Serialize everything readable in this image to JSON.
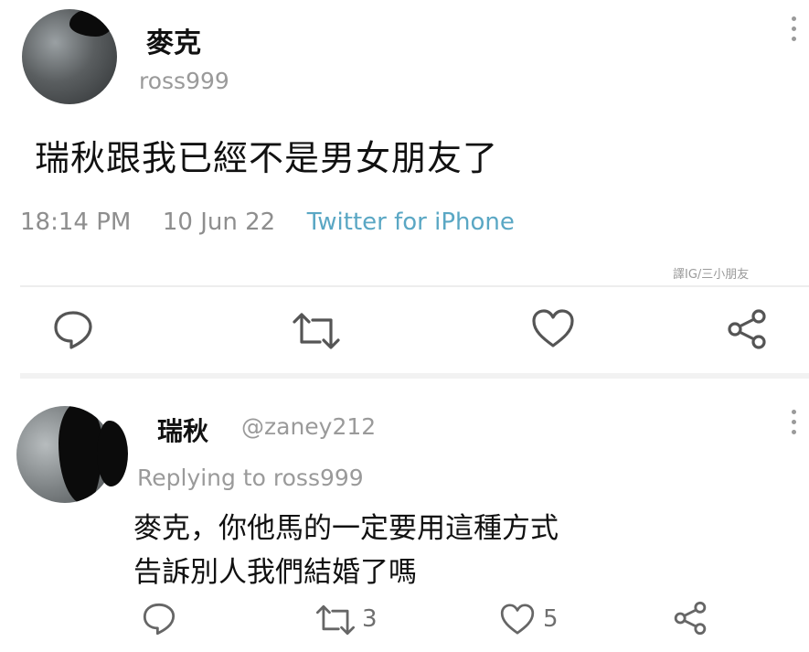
{
  "tweet": {
    "author_name": "麥克",
    "author_handle": "ross999",
    "text": "瑞秋跟我已經不是男女朋友了",
    "time": "18:14 PM",
    "date": "10 Jun 22",
    "source": "Twitter for iPhone",
    "watermark": "譯IG/三小朋友",
    "source_color": "#5aa7c4"
  },
  "actions": {
    "reply_icon": "comment-icon",
    "retweet_icon": "retweet-icon",
    "like_icon": "heart-icon",
    "share_icon": "share-icon"
  },
  "reply": {
    "author_name": "瑞秋",
    "author_handle": "@zaney212",
    "replying_to": "Replying to ross999",
    "text_line1": "麥克，你他馬的一定要用這種方式",
    "text_line2": "告訴別人我們結婚了嗎",
    "retweet_count": "3",
    "like_count": "5"
  }
}
